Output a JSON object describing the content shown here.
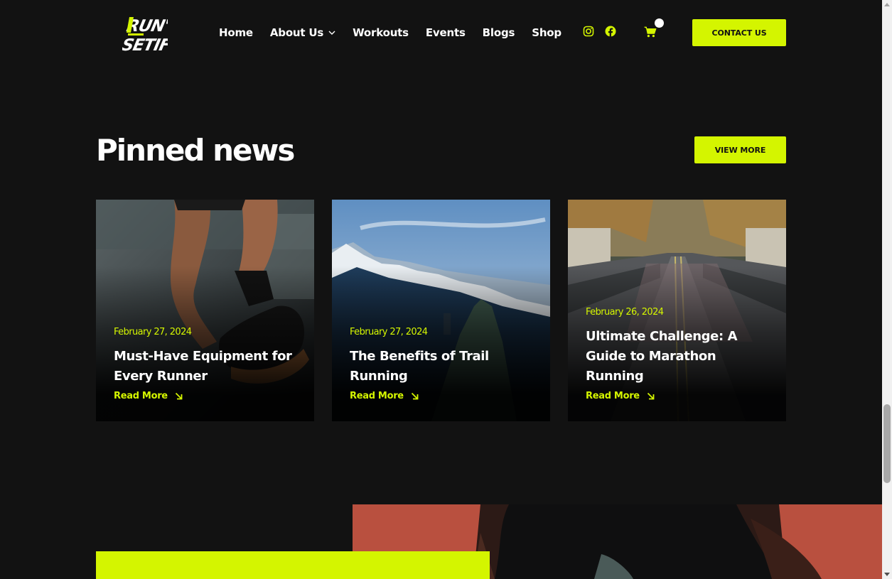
{
  "header": {
    "logo_text": "RUN'IN SETIF",
    "nav": [
      {
        "label": "Home"
      },
      {
        "label": "About Us",
        "has_dropdown": true
      },
      {
        "label": "Workouts"
      },
      {
        "label": "Events"
      },
      {
        "label": "Blogs"
      },
      {
        "label": "Shop"
      }
    ],
    "social_icons": [
      "instagram-icon",
      "facebook-icon"
    ],
    "cart_icon": "shopping-cart-icon",
    "contact_label": "CONTACT US"
  },
  "pinned": {
    "title": "Pinned news",
    "view_more_label": "VIEW MORE",
    "cards": [
      {
        "date": "February 27, 2024",
        "title": "Must-Have Equipment for Every Runner",
        "read_more": "Read More",
        "image": "runner-legs-photo"
      },
      {
        "date": "February 27, 2024",
        "title": "The Benefits of Trail Running",
        "read_more": "Read More",
        "image": "mountain-trail-photo"
      },
      {
        "date": "February 26, 2024",
        "title": "Ultimate Challenge: A Guide to Marathon Running",
        "read_more": "Read More",
        "image": "marathon-crowd-photo"
      }
    ]
  },
  "colors": {
    "background": "#121212",
    "accent": "#d4f500",
    "text": "#ffffff"
  }
}
